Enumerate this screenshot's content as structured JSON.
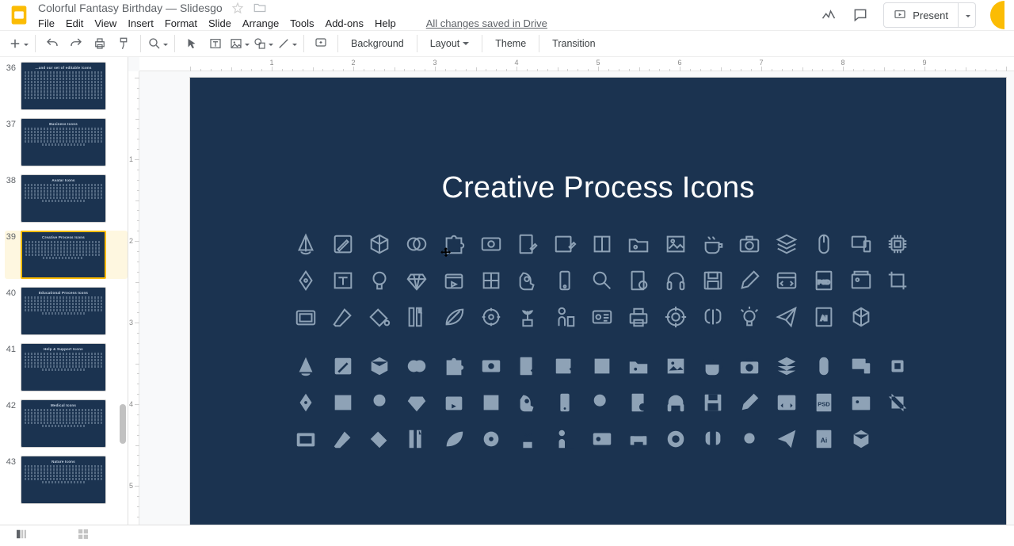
{
  "doc": {
    "title": "Colorful Fantasy Birthday — Slidesgo",
    "saved_text": "All changes saved in Drive"
  },
  "menus": [
    "File",
    "Edit",
    "View",
    "Insert",
    "Format",
    "Slide",
    "Arrange",
    "Tools",
    "Add-ons",
    "Help"
  ],
  "present_label": "Present",
  "toolbar": {
    "background": "Background",
    "layout": "Layout",
    "theme": "Theme",
    "transition": "Transition"
  },
  "ruler_h": [
    "1",
    "2",
    "3",
    "4",
    "5",
    "6",
    "7",
    "8",
    "9"
  ],
  "ruler_v": [
    "1",
    "2",
    "3",
    "4",
    "5"
  ],
  "slide": {
    "title": "Creative Process Icons"
  },
  "thumbs": [
    {
      "n": "36",
      "title": "...and our set of editable icons"
    },
    {
      "n": "37",
      "title": "Business Icons"
    },
    {
      "n": "38",
      "title": "Avatar Icons"
    },
    {
      "n": "39",
      "title": "Creative Process Icons",
      "selected": true
    },
    {
      "n": "40",
      "title": "Educational Process Icons"
    },
    {
      "n": "41",
      "title": "Help & Support Icons"
    },
    {
      "n": "42",
      "title": "Medical Icons"
    },
    {
      "n": "43",
      "title": "Nature Icons"
    }
  ],
  "icons": [
    "compass",
    "pencil-ruler",
    "cube-3d",
    "venn",
    "puzzle",
    "eye-frame",
    "document-pen",
    "image-pen",
    "book",
    "folder-image",
    "picture",
    "coffee",
    "camera",
    "layers",
    "mouse",
    "devices",
    "chip",
    "pen-nib",
    "text-box",
    "bulb",
    "diamond",
    "video",
    "color-grid",
    "head-gear",
    "phone",
    "magnifier",
    "file-settings",
    "headphones",
    "floppy",
    "marker",
    "code-window",
    "psd",
    "gallery",
    "crop",
    "tablet",
    "eraser",
    "paint-bucket",
    "ruler-pen",
    "leaf-pen",
    "gear-badge",
    "plant",
    "figure",
    "id-ruler",
    "printer",
    "target",
    "brain",
    "bulb-spark",
    "paper-plane",
    "ai-file",
    "hex-3d"
  ]
}
